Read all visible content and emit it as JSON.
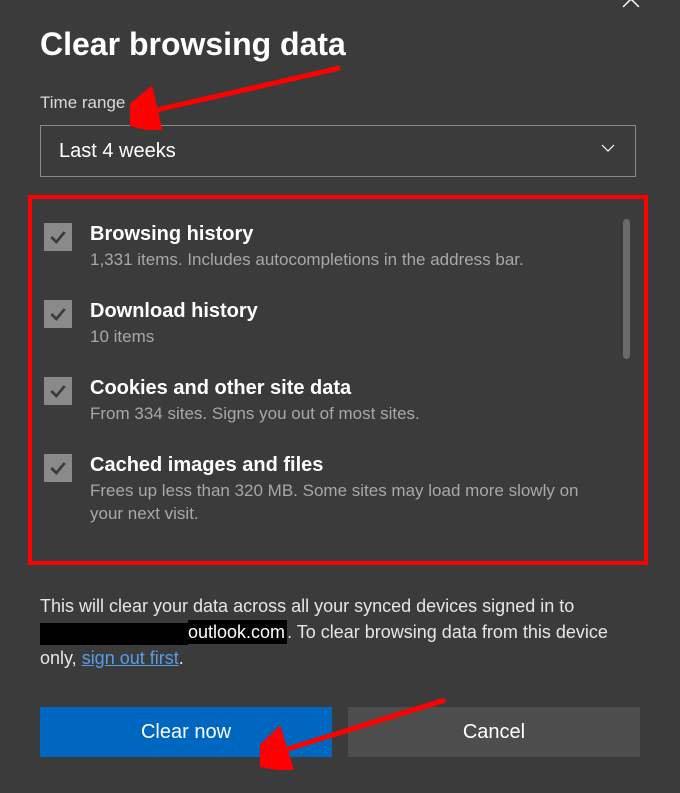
{
  "title": "Clear browsing data",
  "timeRange": {
    "label": "Time range",
    "selected": "Last 4 weeks"
  },
  "options": [
    {
      "checked": true,
      "title": "Browsing history",
      "desc": "1,331 items. Includes autocompletions in the address bar."
    },
    {
      "checked": true,
      "title": "Download history",
      "desc": "10 items"
    },
    {
      "checked": true,
      "title": "Cookies and other site data",
      "desc": "From 334 sites. Signs you out of most sites."
    },
    {
      "checked": true,
      "title": "Cached images and files",
      "desc": "Frees up less than 320 MB. Some sites may load more slowly on your next visit."
    }
  ],
  "info": {
    "part1": "This will clear your data across all your synced devices signed in to ",
    "email_suffix": "outlook.com",
    "part2": ". To clear browsing data from this device only, ",
    "link": "sign out first",
    "part3": "."
  },
  "buttons": {
    "primary": "Clear now",
    "secondary": "Cancel"
  }
}
